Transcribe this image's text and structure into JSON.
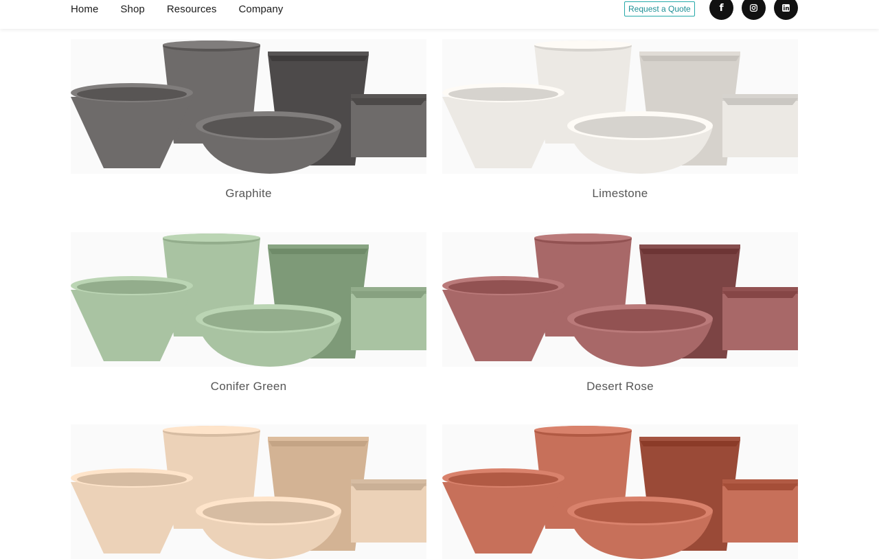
{
  "nav": {
    "items": [
      "Home",
      "Shop",
      "Resources",
      "Company"
    ],
    "quote_label": "Request a Quote"
  },
  "social": [
    {
      "name": "facebook-icon",
      "glyph": "f"
    },
    {
      "name": "instagram-icon",
      "glyph": ""
    },
    {
      "name": "linkedin-icon",
      "glyph": ""
    }
  ],
  "finishes": [
    {
      "label": "Graphite",
      "color": "#6e6b6a",
      "dark": "#4d4a4a"
    },
    {
      "label": "Limestone",
      "color": "#ece9e4",
      "dark": "#d6d2cc"
    },
    {
      "label": "Conifer Green",
      "color": "#a9c3a2",
      "dark": "#7e9a78"
    },
    {
      "label": "Desert Rose",
      "color": "#a86868",
      "dark": "#7c4444"
    },
    {
      "label": "",
      "color": "#ecd2b8",
      "dark": "#d3b394"
    },
    {
      "label": "",
      "color": "#c7705a",
      "dark": "#9a4a37"
    }
  ]
}
